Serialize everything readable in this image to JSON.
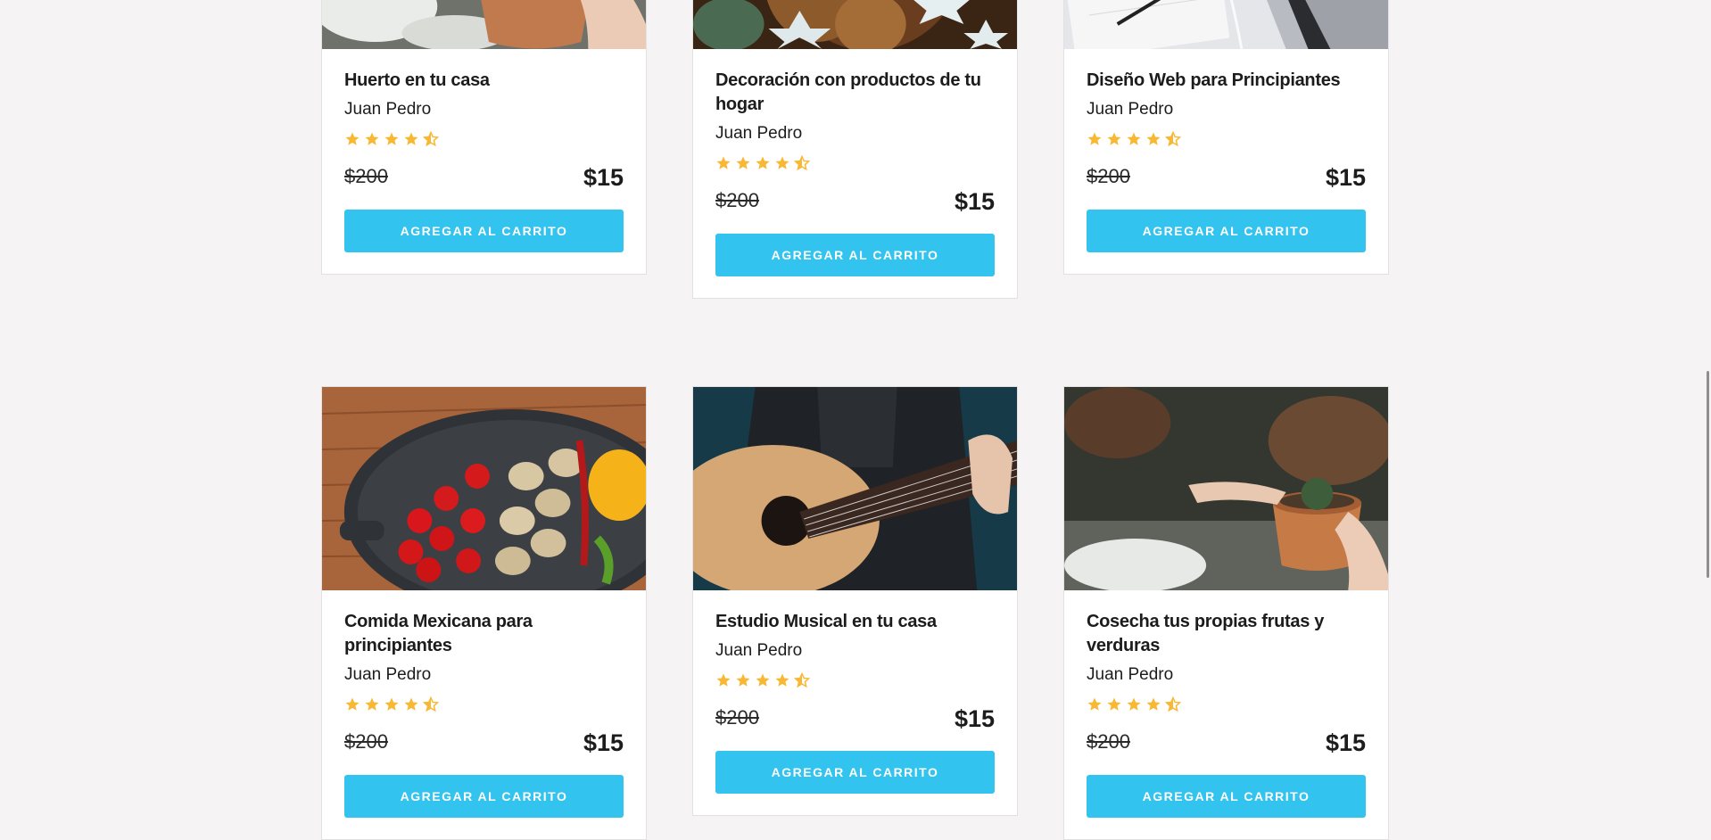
{
  "colors": {
    "accent": "#33c3ef",
    "star": "#f9b834",
    "background": "#f5f3f4"
  },
  "courses": [
    {
      "title": "Huerto en tu casa",
      "author": "Juan Pedro",
      "rating": 4.5,
      "old_price": "$200",
      "price": "$15",
      "button_label": "AGREGAR AL CARRITO",
      "image": "garden-pot-image"
    },
    {
      "title": "Decoración con productos de tu hogar",
      "author": "Juan Pedro",
      "rating": 4.5,
      "old_price": "$200",
      "price": "$15",
      "button_label": "AGREGAR AL CARRITO",
      "image": "pinecone-cookies-image"
    },
    {
      "title": "Diseño Web para Principiantes",
      "author": "Juan Pedro",
      "rating": 4.5,
      "old_price": "$200",
      "price": "$15",
      "button_label": "AGREGAR AL CARRITO",
      "image": "laptop-notebook-image"
    },
    {
      "title": "Comida Mexicana para principiantes",
      "author": "Juan Pedro",
      "rating": 4.5,
      "old_price": "$200",
      "price": "$15",
      "button_label": "AGREGAR AL CARRITO",
      "image": "vegetables-pan-image"
    },
    {
      "title": "Estudio Musical en tu casa",
      "author": "Juan Pedro",
      "rating": 4.5,
      "old_price": "$200",
      "price": "$15",
      "button_label": "AGREGAR AL CARRITO",
      "image": "guitar-player-image"
    },
    {
      "title": "Cosecha tus propias frutas y verduras",
      "author": "Juan Pedro",
      "rating": 4.5,
      "old_price": "$200",
      "price": "$15",
      "button_label": "AGREGAR AL CARRITO",
      "image": "garden-pot-image"
    }
  ]
}
